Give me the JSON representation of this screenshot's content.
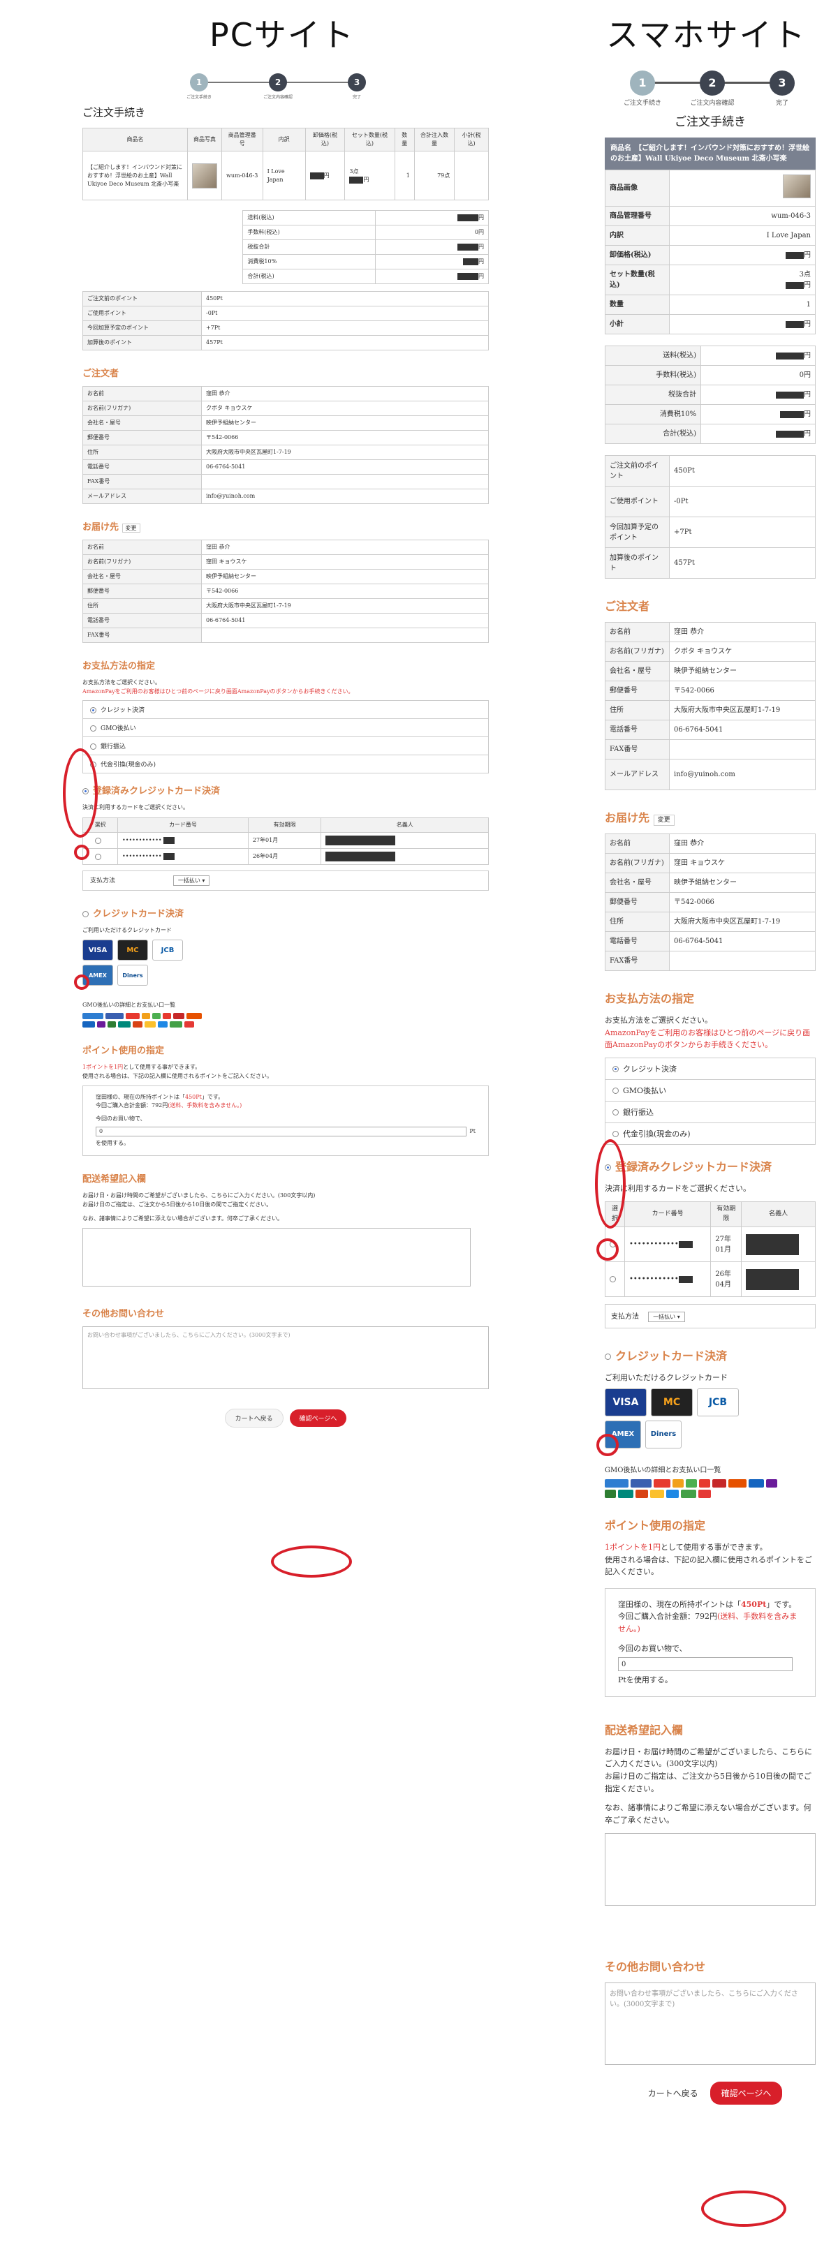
{
  "pc_heading": "PCサイト",
  "sp_heading": "スマホサイト",
  "colors": {
    "accent": "#d9834a",
    "ring": "#d81f2a",
    "step_active": "#3e4450",
    "step_done": "#9fb4bd"
  },
  "steps": {
    "pc": [
      "ご注文手続き",
      "ご注文内容確認",
      "完了"
    ],
    "sp": [
      "ご注文手続き",
      "ご注文内容確認",
      "完了"
    ],
    "numbers": [
      "1",
      "2",
      "3"
    ]
  },
  "order_title": "ご注文手続き",
  "product": {
    "headers": [
      "商品名",
      "商品写真",
      "商品管理番号",
      "内訳",
      "卸価格(税込)",
      "セット数量(税込)",
      "数量",
      "合計注入数量",
      "小計(税込)"
    ],
    "name": "【ご紹介します！インバウンド対策におすすめ！浮世絵のお土産】Wall Ukiyoe Deco Museum 北斎小写楽",
    "code": "wum-046-3",
    "breakdown": "I Love Japan",
    "price_suffix": "円",
    "set_qty": "3点",
    "qty": "1",
    "total_qty": "79点",
    "sp_title": "商品名　【ご紹介します！インバウンド対策におすすめ！浮世絵のお土産】Wall Ukiyoe Deco Museum 北斎小写楽",
    "sp_labels": [
      "商品画像",
      "商品管理番号",
      "内訳",
      "卸価格(税込)",
      "セット数量(税込)",
      "数量",
      "小計"
    ],
    "sp_set_qty": "3点"
  },
  "totals": {
    "labels": [
      "送料(税込)",
      "手数料(税込)",
      "税抜合計",
      "消費税10%",
      "合計(税込)"
    ],
    "fee": "0円",
    "yen": "円"
  },
  "points": {
    "labels": [
      "ご注文前のポイント",
      "ご使用ポイント",
      "今回加算予定のポイント",
      "加算後のポイント"
    ],
    "values": [
      "450Pt",
      "-0Pt",
      "+7Pt",
      "457Pt"
    ]
  },
  "orderer": {
    "title": "ご注文者",
    "labels": [
      "お名前",
      "お名前(フリガナ)",
      "会社名・屋号",
      "郵便番号",
      "住所",
      "電話番号",
      "FAX番号",
      "メールアドレス"
    ],
    "values": [
      "窪田 恭介",
      "クボタ キョウスケ",
      "映伊予組納センター",
      "〒542-0066",
      "大阪府大阪市中央区瓦屋町1-7-19",
      "06-6764-5041",
      "",
      "info@yuinoh.com"
    ]
  },
  "ship": {
    "title": "お届け先",
    "change": "変更",
    "labels": [
      "お名前",
      "お名前(フリガナ)",
      "会社名・屋号",
      "郵便番号",
      "住所",
      "電話番号",
      "FAX番号"
    ],
    "values": [
      "窪田 恭介",
      "窪田 キョウスケ",
      "映伊予組納センター",
      "〒542-0066",
      "大阪府大阪市中央区瓦屋町1-7-19",
      "06-6764-5041",
      ""
    ]
  },
  "payment": {
    "title": "お支払方法の指定",
    "instr": "お支払方法をご選択ください。",
    "warn": "AmazonPayをご利用のお客様はひとつ前のページに戻り画面AmazonPayのボタンからお手続きください。",
    "options": [
      "クレジット決済",
      "GMO後払い",
      "銀行振込",
      "代金引換(現金のみ)"
    ],
    "registered_title": "登録済みクレジットカード決済",
    "registered_instr": "決済に利用するカードをご選択ください。",
    "card_headers": [
      "選択",
      "カード番号",
      "有効期限",
      "名義人"
    ],
    "cards": [
      {
        "number": "••••••••••••",
        "exp": "27年01月"
      },
      {
        "number": "••••••••••••",
        "exp": "26年04月"
      }
    ],
    "pay_method_label": "支払方法",
    "pay_method_value": "一括払い",
    "credit_title": "クレジットカード決済",
    "credit_instr": "ご利用いただけるクレジットカード",
    "brands": [
      "VISA",
      "MC",
      "JCB",
      "AMEX",
      "Diners"
    ],
    "gmo_title": "GMO後払いの詳細とお支払い口一覧"
  },
  "point_use": {
    "title": "ポイント使用の指定",
    "desc1_red": "1ポイントを1円",
    "desc1": "として使用する事ができます。",
    "desc2": "使用される場合は、下記の記入欄に使用されるポイントをご記入ください。",
    "box1": "窪田様の、現在の所持ポイントは「",
    "box_pt": "450Pt",
    "box2": "」です。",
    "box3": "今回ご購入合計金額：792円",
    "box_red": "(送料、手数料を含みません。)",
    "box4": "今回のお買い物で、",
    "input_value": "0",
    "unit": "Pt",
    "box5": "を使用する。",
    "sp_box5": "Ptを使用する。"
  },
  "delivery": {
    "title": "配送希望記入欄",
    "text1": "お届け日・お届け時間のご希望がございましたら、こちらにご入力ください。(300文字以内)",
    "text2": "お届け日のご指定は、ご注文から5日後から10日後の間でご指定ください。",
    "text3": "なお、諸事情によりご希望に添えない場合がございます。何卒ご了承ください。"
  },
  "inquiry": {
    "title": "その他お問い合わせ",
    "placeholder": "お問い合わせ事項がございましたら、こちらにご入力ください。(3000文字まで)"
  },
  "buttons": {
    "back": "カートへ戻る",
    "confirm": "確認ページへ"
  }
}
